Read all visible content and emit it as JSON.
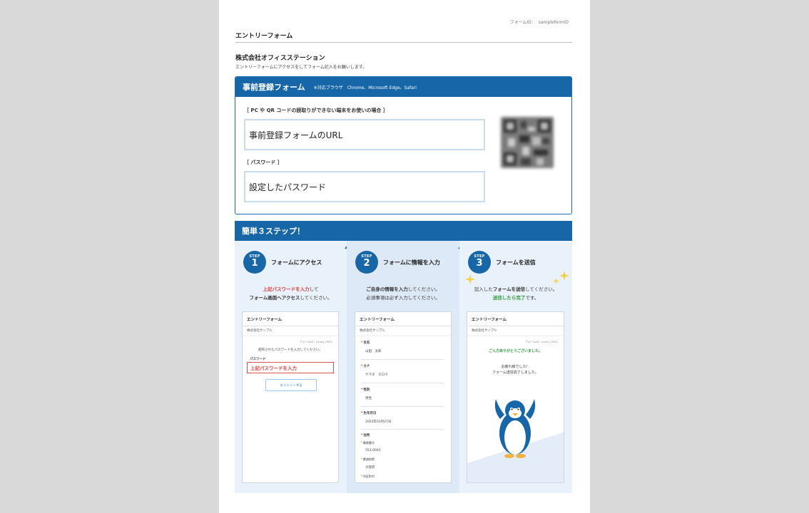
{
  "header": {
    "form_id_label": "フォームID：",
    "form_id_value": "sampleformID",
    "page_title": "エントリーフォーム",
    "company": "株式会社オフィスステーション",
    "intro": "エントリーフォームにアクセスをしてフォーム記入をお願いします。"
  },
  "registration": {
    "title": "事前登録フォーム",
    "browsers": "※対応ブラウザ　Chrome、Microsoft Edge、Safari",
    "url_label": "［ PC や QR コードの読取りができない端末をお使いの場合 ］",
    "url_value": "事前登録フォームのURL",
    "password_label": "［ パスワード ］",
    "password_value": "設定したパスワード",
    "qr_icon": "qr-code-icon"
  },
  "steps": {
    "title": "簡単３ステップ！",
    "step_word": "STEP",
    "accent": "#1767a8",
    "items": [
      {
        "number": "1",
        "title": "フォームにアクセス",
        "desc_red": "上記パスワードを入力",
        "desc_1": "して",
        "desc_bold": "フォーム画面へアクセス",
        "desc_2": "してください。",
        "mock": {
          "title": "エントリーフォーム",
          "company": "株式会社サンプル",
          "formid": "フォームID：s1ax1_0001",
          "instruction": "配布されたパスワードを入力してください。",
          "pw_label": "パスワード",
          "pw_value": "上記パスワードを入力",
          "button": "エントリーする"
        }
      },
      {
        "number": "2",
        "title": "フォームに情報を入力",
        "desc_bold": "ご自身の情報を入力",
        "desc_1": "してください。",
        "desc_2": "必須事項は必ず入力してください。",
        "mock": {
          "title": "エントリーフォーム",
          "company": "株式会社サンプル",
          "fields": [
            {
              "label": "氏名",
              "value": "山田　太郎"
            },
            {
              "label": "カナ",
              "value": "ヤマダ　タロウ"
            },
            {
              "label": "性別",
              "value": "男性"
            },
            {
              "label": "生年月日",
              "value": "2003年01月27日"
            },
            {
              "label": "住所",
              "value": ""
            },
            {
              "label": "郵便番号",
              "value": "553-0043"
            },
            {
              "label": "都道府県",
              "value": "大阪府"
            },
            {
              "label": "市区町村",
              "value": ""
            }
          ]
        }
      },
      {
        "number": "3",
        "title": "フォームを送信",
        "desc_1": "記入した",
        "desc_bold": "フォームを送信",
        "desc_2": "してください。",
        "desc_green": "送信したら完了",
        "desc_3": "です。",
        "mock": {
          "title": "エントリーフォーム",
          "company": "株式会社サンプル",
          "formid": "フォームID：s1ax1_0001",
          "thanks": "ご入力ありがとうございました。",
          "done_1": "お疲れ様でした！",
          "done_2": "フォーム送信完了しました。",
          "illustration": "penguin-icon"
        }
      }
    ]
  }
}
